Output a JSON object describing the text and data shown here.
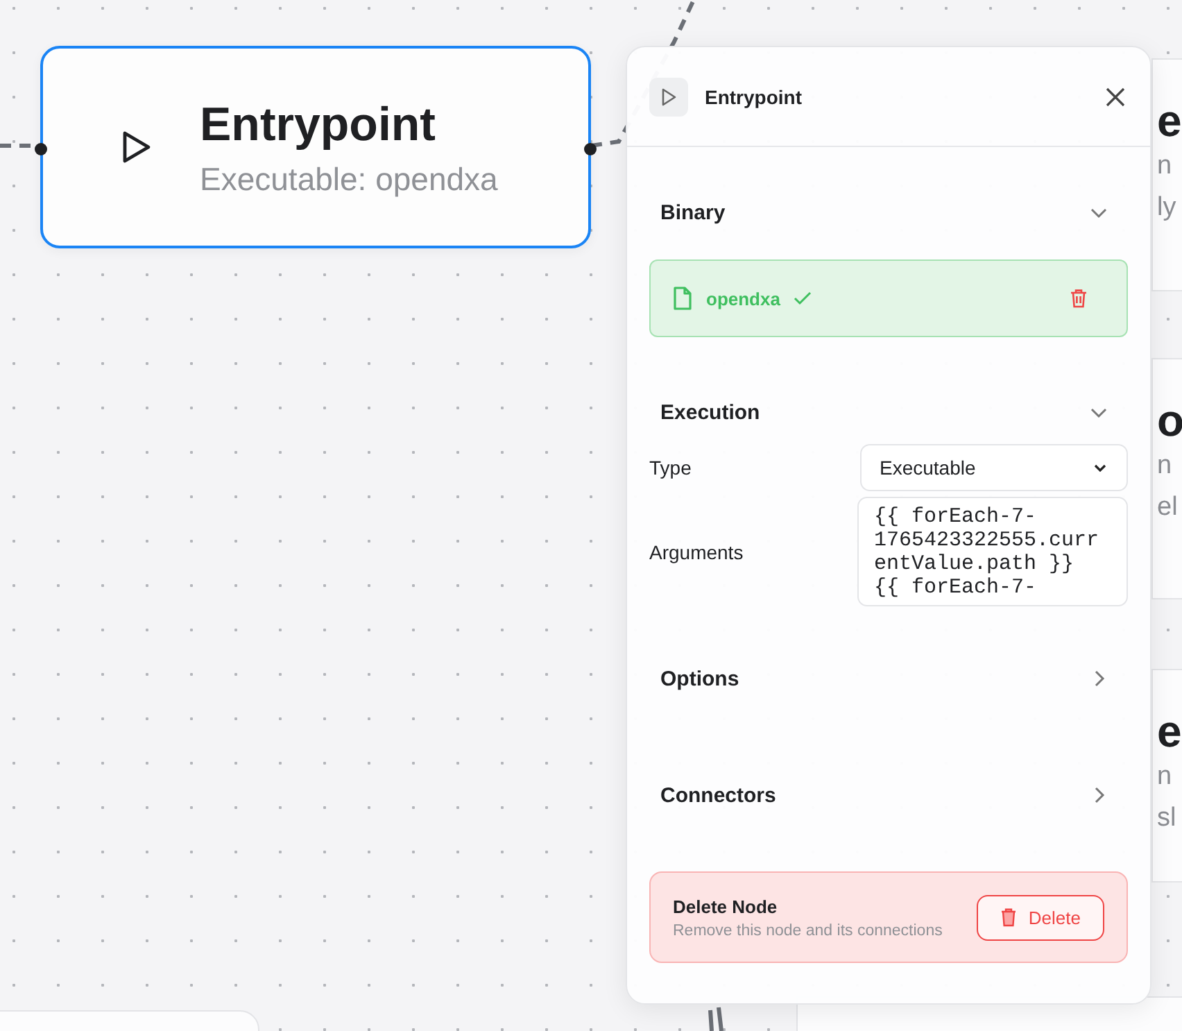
{
  "node": {
    "title": "Entrypoint",
    "subtitle": "Executable: opendxa",
    "selected": true
  },
  "background_nodes": [
    {
      "title": "e",
      "lines": [
        "n",
        "ly"
      ]
    },
    {
      "title": "o",
      "lines": [
        "n",
        "el"
      ]
    },
    {
      "title": "e",
      "lines": [
        "n",
        "sl"
      ]
    }
  ],
  "panel": {
    "title": "Entrypoint",
    "binary": {
      "title": "Binary",
      "expanded": true,
      "file": {
        "name": "opendxa",
        "valid": true
      }
    },
    "execution": {
      "title": "Execution",
      "expanded": true,
      "type_label": "Type",
      "type_value": "Executable",
      "arguments_label": "Arguments",
      "arguments_value": "{{ forEach-7-1765423322555.currentValue.path }} {{ forEach-7-"
    },
    "options": {
      "title": "Options",
      "expanded": false
    },
    "connectors": {
      "title": "Connectors",
      "expanded": false
    },
    "danger": {
      "title": "Delete Node",
      "description": "Remove this node and its connections",
      "button": "Delete"
    }
  }
}
